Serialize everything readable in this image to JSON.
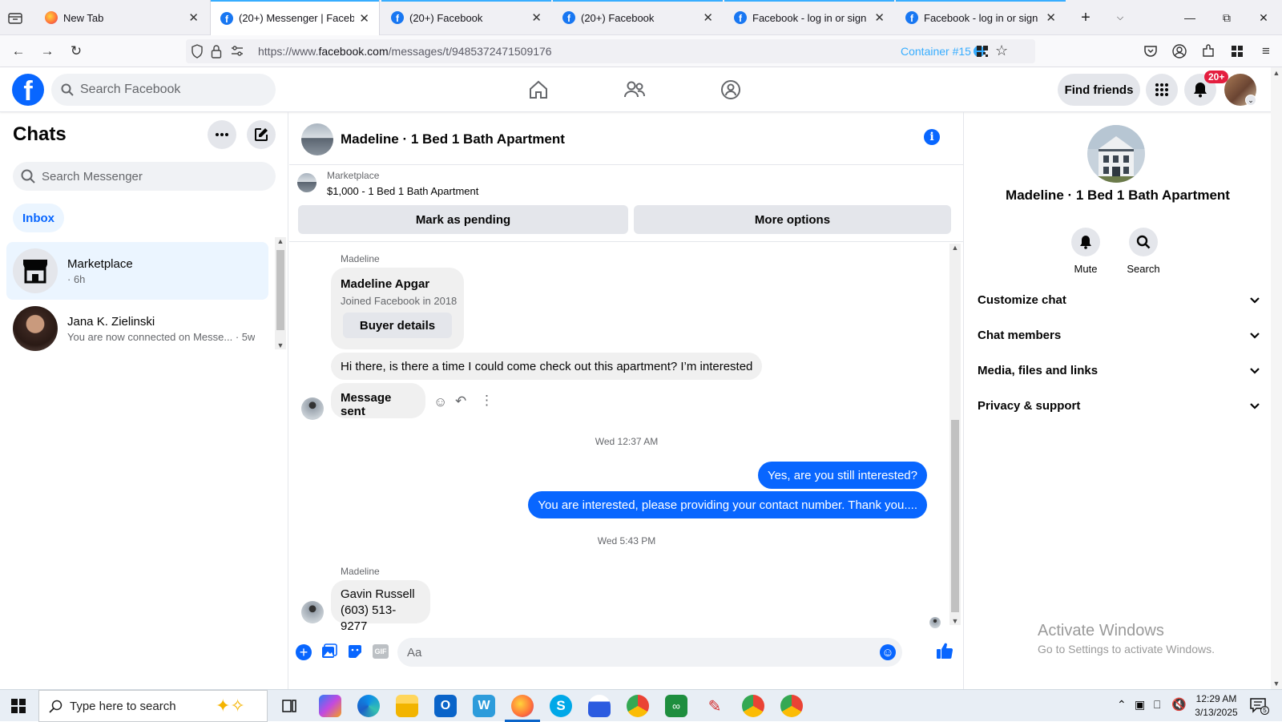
{
  "browser": {
    "tabs": [
      {
        "title": "New Tab",
        "icon": "firefox-icon"
      },
      {
        "title": "(20+) Messenger | Facebook",
        "icon": "facebook-icon",
        "active": true
      },
      {
        "title": "(20+) Facebook",
        "icon": "facebook-icon"
      },
      {
        "title": "(20+) Facebook",
        "icon": "facebook-icon"
      },
      {
        "title": "Facebook - log in or sign up",
        "icon": "facebook-icon"
      },
      {
        "title": "Facebook - log in or sign up",
        "icon": "facebook-icon"
      }
    ],
    "url_prefix": "https://www.",
    "url_domain": "facebook.com",
    "url_path": "/messages/t/9485372471509176",
    "container": "Container #15",
    "container_color": "#37adff"
  },
  "header": {
    "search_placeholder": "Search Facebook",
    "find_friends": "Find friends",
    "notification_badge": "20+",
    "brand_color": "#0866ff"
  },
  "chats": {
    "title": "Chats",
    "search_placeholder": "Search Messenger",
    "filter": "Inbox",
    "items": [
      {
        "name": "Marketplace",
        "sub": "· 6h"
      },
      {
        "name": "Jana K. Zielinski",
        "sub": "You are now connected on Messe... · 5w"
      }
    ]
  },
  "conversation": {
    "title": "Madeline · 1 Bed 1 Bath Apartment",
    "marketplace_label": "Marketplace",
    "listing": "$1,000 - 1 Bed 1 Bath Apartment",
    "mark_pending": "Mark as pending",
    "more_options": "More options",
    "messages": {
      "sender1": "Madeline",
      "card_name": "Madeline Apgar",
      "card_sub": "Joined Facebook in 2018",
      "buyer_details": "Buyer details",
      "inquiry": "Hi there, is there a time I could come check out this apartment? I’m interested",
      "message_sent": "Message sent",
      "ts1": "Wed 12:37 AM",
      "out1": "Yes, are you still interested?",
      "out2": "You are interested, please providing your contact number. Thank you....",
      "ts2": "Wed 5:43 PM",
      "sender2": "Madeline",
      "reply_line1": "Gavin Russell",
      "reply_line2": "(603) 513-9277"
    },
    "composer_placeholder": "Aa"
  },
  "details": {
    "name": "Madeline · 1 Bed 1 Bath Apartment",
    "mute": "Mute",
    "search": "Search",
    "sections": [
      "Customize chat",
      "Chat members",
      "Media, files and links",
      "Privacy & support"
    ]
  },
  "watermark": {
    "line1": "Activate Windows",
    "line2": "Go to Settings to activate Windows."
  },
  "taskbar": {
    "search_placeholder": "Type here to search",
    "time": "12:29 AM",
    "date": "3/13/2025",
    "notif_count": "5"
  }
}
